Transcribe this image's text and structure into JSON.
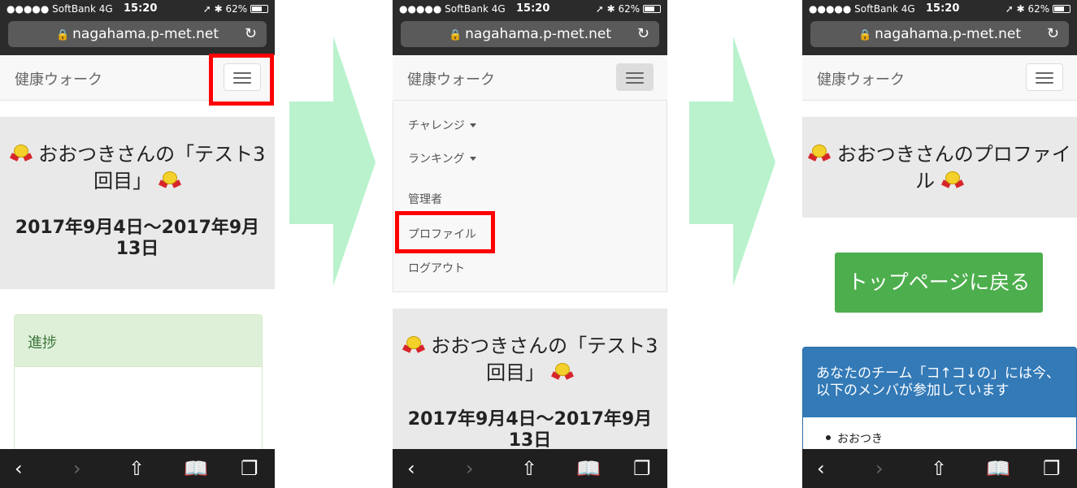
{
  "status_bar": {
    "carrier": "●●●●● SoftBank  4G",
    "time": "15:20",
    "battery": "62%"
  },
  "browser": {
    "url": "nagahama.p-met.net"
  },
  "navbar": {
    "brand": "健康ウォーク"
  },
  "challenge": {
    "title": "おおつきさんの「テスト3回目」",
    "period": "2017年9月4日〜2017年9月13日"
  },
  "progress_panel": {
    "heading": "進捗"
  },
  "menu": {
    "items": [
      "チャレンジ",
      "ランキング",
      "管理者",
      "プロファイル",
      "ログアウト"
    ]
  },
  "profile": {
    "title": "おおつきさんのプロファイル",
    "back_button": "トップページに戻る",
    "team_heading": "あなたのチーム「コ↑コ↓の」には今、以下のメンバが参加しています",
    "members": [
      "おおつき"
    ]
  },
  "colors": {
    "highlight": "#ff0000",
    "arrow": "#b9f2cd",
    "success": "#4cae4c",
    "primary": "#337ab7"
  }
}
